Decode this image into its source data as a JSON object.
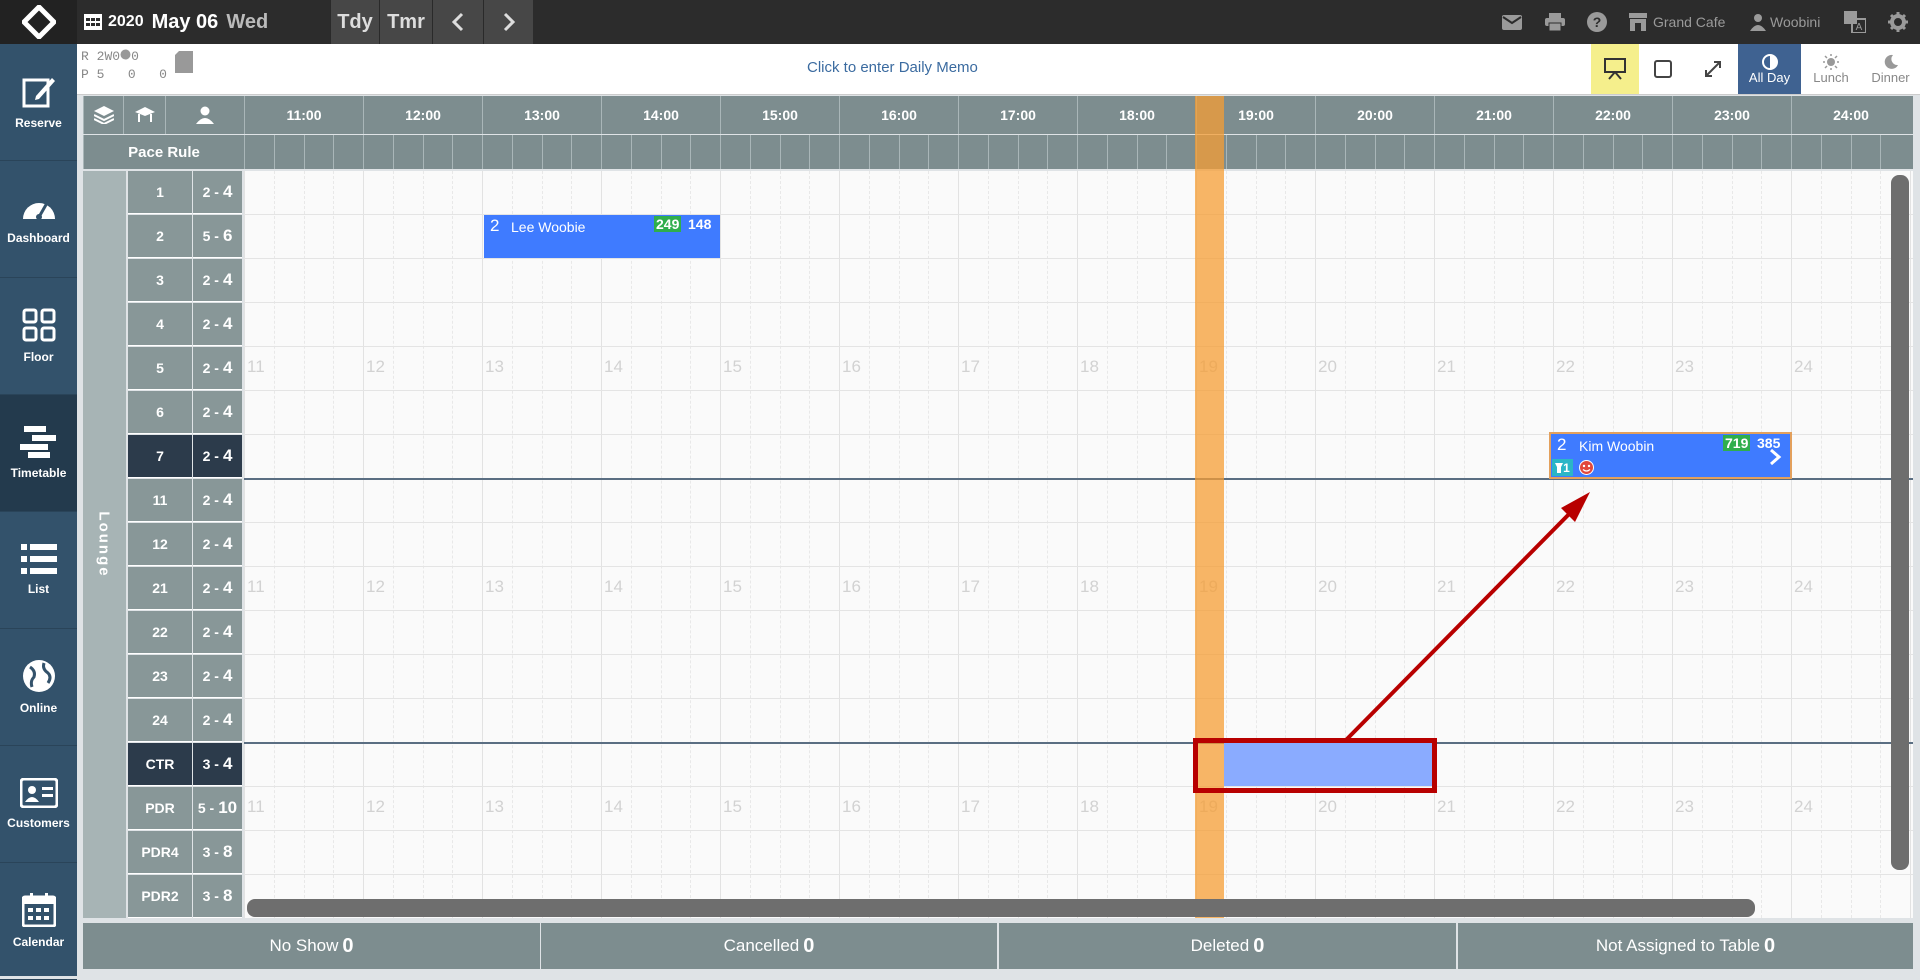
{
  "header": {
    "year": "2020",
    "month_day": "May 06",
    "weekday": "Wed",
    "today_label": "Tdy",
    "tomorrow_label": "Tmr",
    "restaurant": "Grand Cafe",
    "user": "Woobini"
  },
  "sidebar": {
    "items": [
      {
        "label": "Reserve",
        "icon": "edit-icon"
      },
      {
        "label": "Dashboard",
        "icon": "gauge-icon"
      },
      {
        "label": "Floor",
        "icon": "floor-grid-icon"
      },
      {
        "label": "Timetable",
        "icon": "timetable-icon",
        "active": true
      },
      {
        "label": "List",
        "icon": "list-icon"
      },
      {
        "label": "Online",
        "icon": "globe-icon"
      },
      {
        "label": "Customers",
        "icon": "customer-card-icon"
      },
      {
        "label": "Calendar",
        "icon": "calendar-icon"
      }
    ]
  },
  "subheader": {
    "stats": {
      "r": "R",
      "r1": "2",
      "w": "W",
      "r2": "0",
      "r3": "0",
      "p": "P",
      "p1": "5",
      "p2": "0",
      "p3": "0"
    },
    "memo": "Click to enter Daily Memo",
    "views": {
      "all_day": "All Day",
      "lunch": "Lunch",
      "dinner": "Dinner"
    }
  },
  "timeline": {
    "hours": [
      "11:00",
      "12:00",
      "13:00",
      "14:00",
      "15:00",
      "16:00",
      "17:00",
      "18:00",
      "19:00",
      "20:00",
      "21:00",
      "22:00",
      "23:00",
      "24:00"
    ],
    "ghost_hours": [
      "11",
      "12",
      "13",
      "14",
      "15",
      "16",
      "17",
      "18",
      "19",
      "20",
      "21",
      "22",
      "23",
      "24"
    ],
    "pace_label": "Pace Rule",
    "section": "Lounge"
  },
  "tables": [
    {
      "name": "1",
      "min": "2",
      "max": "4"
    },
    {
      "name": "2",
      "min": "5",
      "max": "6"
    },
    {
      "name": "3",
      "min": "2",
      "max": "4"
    },
    {
      "name": "4",
      "min": "2",
      "max": "4"
    },
    {
      "name": "5",
      "min": "2",
      "max": "4"
    },
    {
      "name": "6",
      "min": "2",
      "max": "4"
    },
    {
      "name": "7",
      "min": "2",
      "max": "4",
      "highlight": true
    },
    {
      "name": "11",
      "min": "2",
      "max": "4"
    },
    {
      "name": "12",
      "min": "2",
      "max": "4"
    },
    {
      "name": "21",
      "min": "2",
      "max": "4"
    },
    {
      "name": "22",
      "min": "2",
      "max": "4"
    },
    {
      "name": "23",
      "min": "2",
      "max": "4"
    },
    {
      "name": "24",
      "min": "2",
      "max": "4"
    },
    {
      "name": "CTR",
      "min": "3",
      "max": "4",
      "highlight": true
    },
    {
      "name": "PDR",
      "min": "5",
      "max": "10"
    },
    {
      "name": "PDR4",
      "min": "3",
      "max": "8"
    },
    {
      "name": "PDR2",
      "min": "3",
      "max": "8"
    }
  ],
  "reservations": [
    {
      "party": "2",
      "name": "Lee Woobie",
      "code_a": "249",
      "code_b": "148"
    },
    {
      "party": "2",
      "name": "Kim Woobin",
      "code_a": "719",
      "code_b": "385",
      "badge": "1"
    }
  ],
  "footer": {
    "no_show_label": "No Show",
    "no_show": "0",
    "cancelled_label": "Cancelled",
    "cancelled": "0",
    "deleted_label": "Deleted",
    "deleted": "0",
    "not_assigned_label": "Not Assigned to Table",
    "not_assigned": "0"
  },
  "colors": {
    "sidebar": "#33526b",
    "reservation": "#3f7bff",
    "now_marker": "#f69e34",
    "annotation": "#b80000"
  }
}
